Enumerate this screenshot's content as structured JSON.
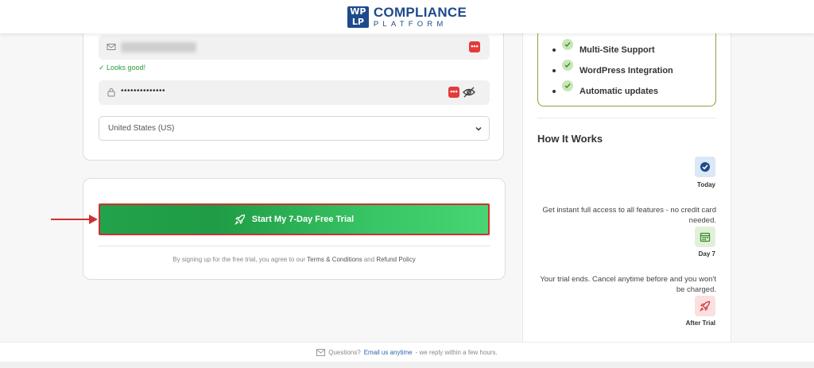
{
  "header": {
    "logo_mark": [
      "WP",
      "LP"
    ],
    "logo_line1": "COMPLIANCE",
    "logo_line2": "PLATFORM"
  },
  "form": {
    "email_validation": "✓ Looks good!",
    "password_value": "••••••••••••••",
    "country_selected": "United States (US)"
  },
  "cta": {
    "button_label": "Start My 7-Day Free Trial",
    "terms_prefix": "By signing up for the free trial, you agree to our",
    "terms_link": "Terms & Conditions",
    "terms_and": "and",
    "refund_link": "Refund Policy"
  },
  "features": {
    "items": [
      "Multi-Site Support",
      "WordPress Integration",
      "Automatic updates"
    ]
  },
  "how_it_works": {
    "title": "How It Works",
    "steps": [
      {
        "label": "Today",
        "desc": "Get instant full access to all features - no credit card needed."
      },
      {
        "label": "Day 7",
        "desc": "Your trial ends. Cancel anytime before and you won't be charged."
      },
      {
        "label": "After Trial",
        "desc": ""
      }
    ]
  },
  "footer": {
    "question": "Questions?",
    "email_link": "Email us anytime",
    "reply_note": "- we reply within a few hours."
  },
  "colors": {
    "brand": "#1e4a8c",
    "cta_green": "#22a24a",
    "highlight_red": "#d0302f",
    "feature_border": "#86a83a"
  }
}
